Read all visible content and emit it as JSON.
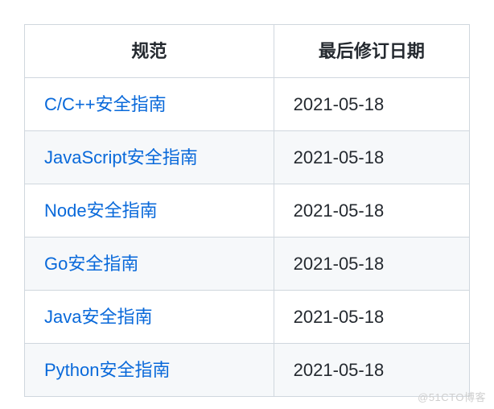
{
  "table": {
    "headers": {
      "spec": "规范",
      "date": "最后修订日期"
    },
    "rows": [
      {
        "name": "C/C++安全指南",
        "date": "2021-05-18"
      },
      {
        "name": "JavaScript安全指南",
        "date": "2021-05-18"
      },
      {
        "name": "Node安全指南",
        "date": "2021-05-18"
      },
      {
        "name": "Go安全指南",
        "date": "2021-05-18"
      },
      {
        "name": "Java安全指南",
        "date": "2021-05-18"
      },
      {
        "name": "Python安全指南",
        "date": "2021-05-18"
      }
    ]
  },
  "watermark": "@51CTO博客"
}
